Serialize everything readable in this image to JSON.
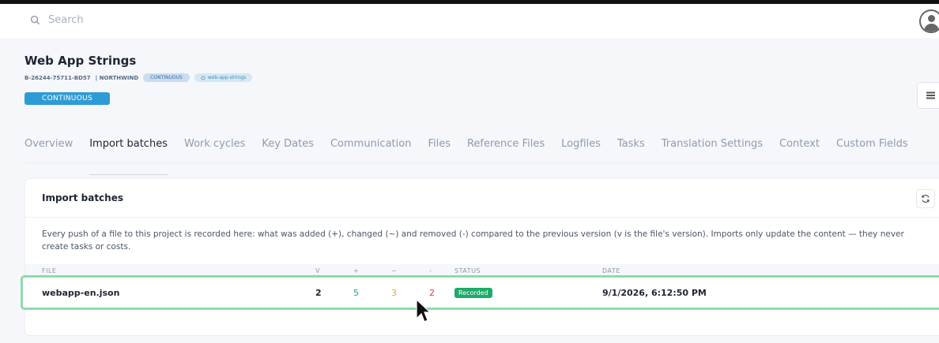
{
  "search": {
    "placeholder": "Search"
  },
  "project": {
    "title": "Web App Strings",
    "code": "B-26244-75711-BD57",
    "client": "| NORTHWIND",
    "tag_mode": "CONTINUOUS",
    "tag_repo": "web-app-strings",
    "status": "CONTINUOUS"
  },
  "tabs": [
    {
      "label": "Overview",
      "active": false
    },
    {
      "label": "Import batches",
      "active": true
    },
    {
      "label": "Work cycles",
      "active": false
    },
    {
      "label": "Key Dates",
      "active": false
    },
    {
      "label": "Communication",
      "active": false
    },
    {
      "label": "Files",
      "active": false
    },
    {
      "label": "Reference Files",
      "active": false
    },
    {
      "label": "Logfiles",
      "active": false
    },
    {
      "label": "Tasks",
      "active": false
    },
    {
      "label": "Translation Settings",
      "active": false
    },
    {
      "label": "Context",
      "active": false
    },
    {
      "label": "Custom Fields",
      "active": false
    }
  ],
  "card": {
    "title": "Import batches",
    "description": "Every push of a file to this project is recorded here: what was added (+), changed (~) and removed (-) compared to the previous version (v is the file's version). Imports only update the content — they never create tasks or costs.",
    "columns": {
      "file": "FILE",
      "v": "V",
      "added": "+",
      "changed": "~",
      "removed": "-",
      "status": "STATUS",
      "date": "DATE"
    },
    "rows": [
      {
        "file": "webapp-en.json",
        "v": "2",
        "added": "5",
        "changed": "3",
        "removed": "2",
        "status": "Recorded",
        "date": "9/1/2026, 6:12:50 PM"
      }
    ]
  },
  "colors": {
    "accent": "#2f9bd6",
    "added": "#1faa6a",
    "changed": "#e8a33a",
    "removed": "#e0413a",
    "row_highlight": "#8fdba9"
  }
}
